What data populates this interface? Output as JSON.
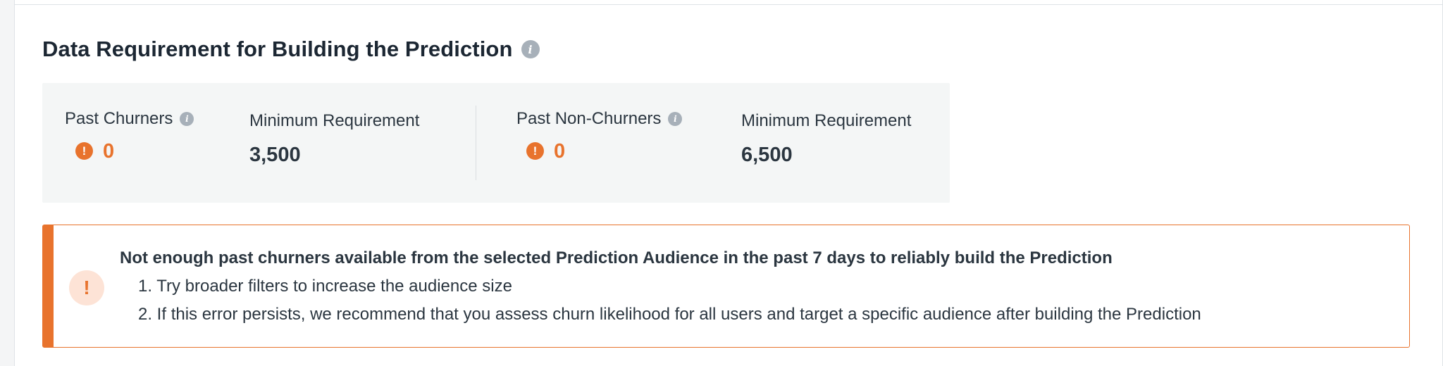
{
  "section": {
    "title": "Data Requirement for Building the Prediction",
    "title_info_icon": "info-icon"
  },
  "requirements": {
    "churners": {
      "label": "Past Churners",
      "value": "0",
      "status_icon": "warning-icon",
      "min_label": "Minimum Requirement",
      "min_value": "3,500"
    },
    "non_churners": {
      "label": "Past Non-Churners",
      "value": "0",
      "status_icon": "warning-icon",
      "min_label": "Minimum Requirement",
      "min_value": "6,500"
    }
  },
  "alert": {
    "icon": "exclamation-icon",
    "icon_glyph": "!",
    "title": "Not enough past churners available from the selected Prediction Audience in the past 7 days to reliably build the Prediction",
    "items": [
      "1. Try broader filters to increase the audience size",
      "2. If this error persists, we recommend that you assess churn likelihood for all users and target a specific audience after building the Prediction"
    ]
  },
  "colors": {
    "accent_orange": "#e8732d",
    "alert_icon_bg": "#fde3d6",
    "panel_bg": "#f4f6f6",
    "info_icon": "#a7b0b9",
    "text_dark": "#1c2733"
  }
}
